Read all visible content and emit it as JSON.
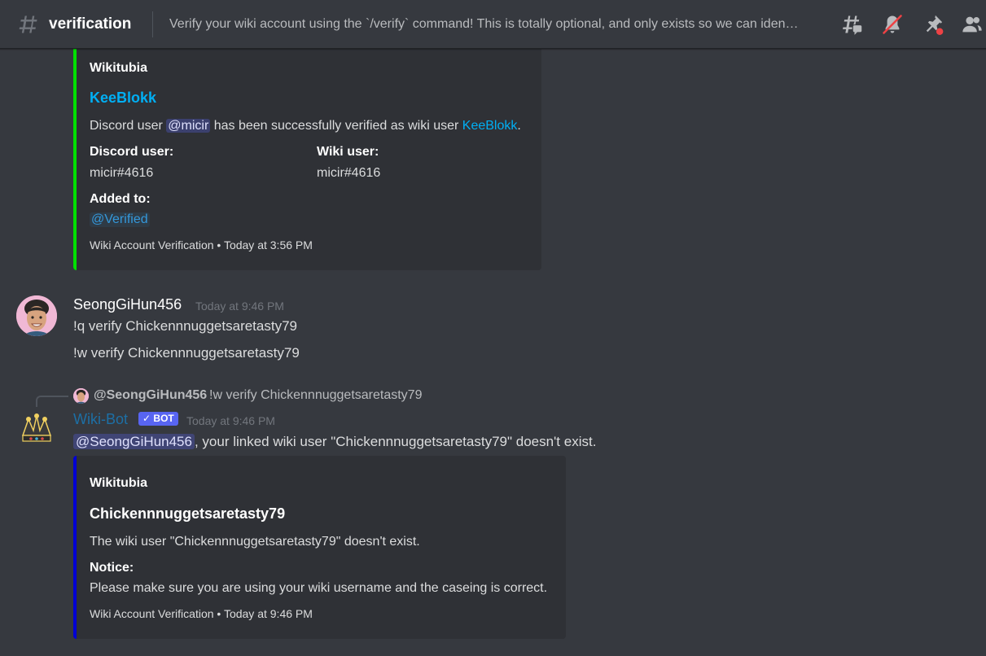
{
  "header": {
    "channel_name": "verification",
    "topic": "Verify your wiki account using the `/verify` command! This is totally optional, and only exists so we can iden…",
    "icons": [
      "hashtag-icon",
      "threads-icon",
      "notifications-muted-icon",
      "pinned-messages-icon",
      "member-list-icon"
    ]
  },
  "colors": {
    "background": "#36393f",
    "embed_background": "#2f3136",
    "embed_success_bar": "#00e000",
    "embed_error_bar": "#0000d4",
    "link": "#00aff4",
    "bot_name": "#1d6fa5",
    "bot_tag": "#5865f2",
    "unread_dot": "#ed4245"
  },
  "embed1": {
    "provider": "Wikitubia",
    "title": "KeeBlokk",
    "desc_prefix": "Discord user",
    "desc_mention": "@micir",
    "desc_middle": "has been successfully verified as wiki user",
    "desc_link": "KeeBlokk",
    "desc_suffix": ".",
    "fields": [
      {
        "name": "Discord user:",
        "value": "micir#4616"
      },
      {
        "name": "Wiki user:",
        "value": "micir#4616"
      },
      {
        "name": "Added to:",
        "value": "@Verified"
      }
    ],
    "footer_text": "Wiki Account Verification",
    "footer_sep": "•",
    "footer_time": "Today at 3:56 PM"
  },
  "message1": {
    "username": "SeongGiHun456",
    "timestamp": "Today at 9:46 PM",
    "lines": [
      "!q verify Chickennnuggetsaretasty79",
      "!w verify Chickennnuggetsaretasty79"
    ]
  },
  "message2": {
    "reply": {
      "username": "@SeongGiHun456",
      "text": "!w verify Chickennnuggetsaretasty79"
    },
    "username": "Wiki-Bot",
    "bot_tag": "BOT",
    "bot_tag_check": "✓",
    "timestamp": "Today at 9:46 PM",
    "mention": "@SeongGiHun456",
    "text": ", your linked wiki user \"Chickennnuggetsaretasty79\" doesn't exist."
  },
  "embed2": {
    "provider": "Wikitubia",
    "title": "Chickennnuggetsaretasty79",
    "desc": "The wiki user \"Chickennnuggetsaretasty79\" doesn't exist.",
    "field_name": "Notice:",
    "field_value": "Please make sure you are using your wiki username and the caseing is correct.",
    "footer_text": "Wiki Account Verification",
    "footer_sep": "•",
    "footer_time": "Today at 9:46 PM"
  }
}
